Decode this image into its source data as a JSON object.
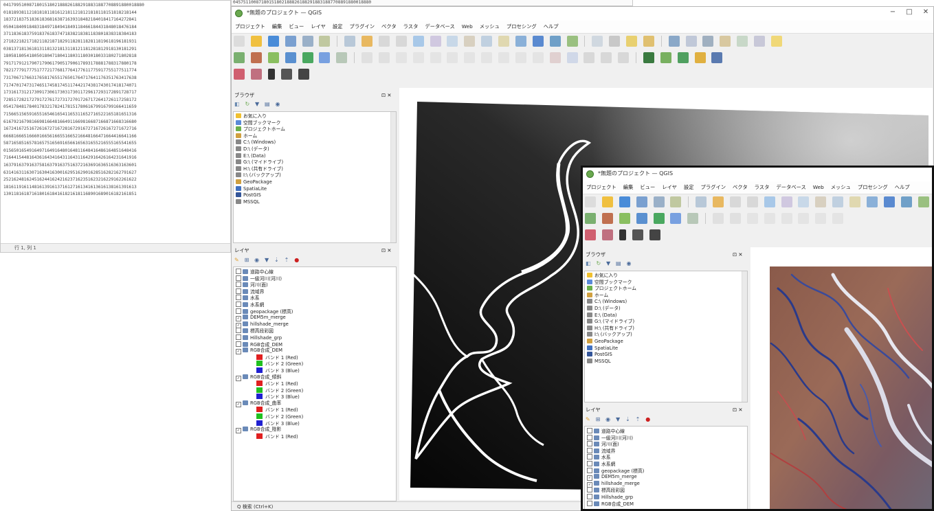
{
  "editor": {
    "lines": [
      "0417995100871801518021888261882918831887708891880018880",
      "0181893811218181811816121811218121818118151818218144",
      "1837218375183618368163871639318482184018417164272841",
      "0504184091848318497184941849118466184431848018476184",
      "3711836183759183761837471838218381183801838318384183",
      "2718221821718211821871829118281182811819618196181931",
      "0381371813618131181321813118121181281812918130181291",
      "1805818054180501804718041180311803018033180271802818",
      "7917179121790717906179051790617893178881788317880178",
      "7821777917775177721776817764177611775917755177511774",
      "7317067176631765817655176501764717641176351763417638",
      "7174701747317465174581745117442174381743017418174071",
      "1731617312173091730617303173011729617293172891728717",
      "7285172821727917276172731727017267172641726117258172",
      "0541784817840178321782417815178061679916799166411659",
      "7156651565916551654616541165311652716522165181651316",
      "6167921679816698166481664911669816687166871668316680",
      "1672416725167261672716728167291672716726167271672716",
      "6668166651666016656166551665216648166471664416641166",
      "5871658516578165751656916566165631655216555165541655",
      "0156501654916497164916480164811648416486164851648416",
      "7164415448164361643416431164311642916426164231641916",
      "1637916379163758163791637516372163691636516363163601",
      "6314163116307163041630016295162901628516282162791627",
      "2521624816245162441624216237162351623216229162261622",
      "1816119161148161391613716127161341613616138161391613",
      "1301181618716180161841618216181168901689016182161851"
    ],
    "status": "行 1, 列 1"
  },
  "top_strip": "045751100871801518021888261882918831887708891880018880",
  "qgis_back": {
    "title": "*無題のプロジェクト — QGIS",
    "window_buttons": [
      "−",
      "□",
      "✕"
    ],
    "menus": [
      "プロジェクト",
      "編集",
      "ビュー",
      "レイヤ",
      "設定",
      "プラグイン",
      "ベクタ",
      "ラスタ",
      "データベース",
      "Web",
      "メッシュ",
      "プロセシング",
      "ヘルプ"
    ],
    "browser_title": "ブラウザ",
    "layers_title": "レイヤ",
    "close_glyph": "⊡ ✕",
    "browser_items": [
      {
        "label": "お気に入り",
        "icon": "#f0c030"
      },
      {
        "label": "空間ブックマーク",
        "icon": "#5a8ad8"
      },
      {
        "label": "プロジェクトホーム",
        "icon": "#6ab04c"
      },
      {
        "label": "ホーム",
        "icon": "#d0a040"
      },
      {
        "label": "C:\\ (Windows)",
        "icon": "#888888"
      },
      {
        "label": "D:\\ (データ)",
        "icon": "#888888"
      },
      {
        "label": "E:\\ (Data)",
        "icon": "#888888"
      },
      {
        "label": "G:\\ (マイドライブ)",
        "icon": "#888888"
      },
      {
        "label": "H:\\ (共有ドライブ)",
        "icon": "#888888"
      },
      {
        "label": "I:\\ (バックアップ)",
        "icon": "#888888"
      },
      {
        "label": "GeoPackage",
        "icon": "#d0a040"
      },
      {
        "label": "SpatiaLite",
        "icon": "#4070c0"
      },
      {
        "label": "PostGIS",
        "icon": "#335599"
      },
      {
        "label": "MSSQL",
        "icon": "#888888"
      }
    ],
    "layer_items": [
      {
        "label": "道路中心線",
        "checked": false
      },
      {
        "label": "一級河川(河川)",
        "checked": false
      },
      {
        "label": "河川(面)",
        "checked": false
      },
      {
        "label": "流域界",
        "checked": false
      },
      {
        "label": "水系",
        "checked": false
      },
      {
        "label": "水系網",
        "checked": false
      },
      {
        "label": "geopackage (標高)",
        "checked": false
      },
      {
        "label": "DEM5m_merge",
        "checked": true
      },
      {
        "label": "hillshade_merge",
        "checked": true
      },
      {
        "label": "標高段彩図",
        "checked": false
      },
      {
        "label": "Hillshade_grp",
        "checked": false
      },
      {
        "label": "RGB合成_DEM",
        "checked": false
      }
    ],
    "band_groups": [
      {
        "bands": [
          {
            "label": "バンド 1 (Red)",
            "color": "#e02020"
          },
          {
            "label": "バンド 2 (Green)",
            "color": "#20c020"
          },
          {
            "label": "バンド 3 (Blue)",
            "color": "#2020d0"
          }
        ]
      },
      {
        "bands": [
          {
            "label": "バンド 1 (Red)",
            "color": "#e02020"
          },
          {
            "label": "バンド 2 (Green)",
            "color": "#20c020"
          },
          {
            "label": "バンド 3 (Blue)",
            "color": "#2020d0"
          }
        ]
      },
      {
        "bands": [
          {
            "label": "バンド 1 (Red)",
            "color": "#e02020"
          },
          {
            "label": "バンド 2 (Green)",
            "color": "#20c020"
          },
          {
            "label": "バンド 3 (Blue)",
            "color": "#2020d0"
          }
        ]
      },
      {
        "bands": [
          {
            "label": "バンド 1 (Red)",
            "color": "#e02020"
          }
        ]
      }
    ],
    "group_labels": [
      "RGB合成_DEM",
      "RGB合成_傾斜",
      "RGB合成_曲率",
      "RGB合成_陰影"
    ],
    "status_text": "Q 検索 (Ctrl+K)"
  },
  "qgis_front": {
    "title": "*無題のプロジェクト — QGIS",
    "menus": [
      "プロジェクト",
      "編集",
      "ビュー",
      "レイヤ",
      "設定",
      "プラグイン",
      "ベクタ",
      "ラスタ",
      "データベース",
      "Web",
      "メッシュ",
      "プロセシング",
      "ヘルプ"
    ],
    "browser_title": "ブラウザ",
    "layers_title": "レイヤ"
  },
  "colors": {
    "accent_green": "#6ab04c",
    "dem_dark": "#111111",
    "dem_light": "#c8c8c8",
    "rgb_red": "#e02020",
    "rgb_green": "#20c020",
    "rgb_blue": "#2020d0"
  }
}
